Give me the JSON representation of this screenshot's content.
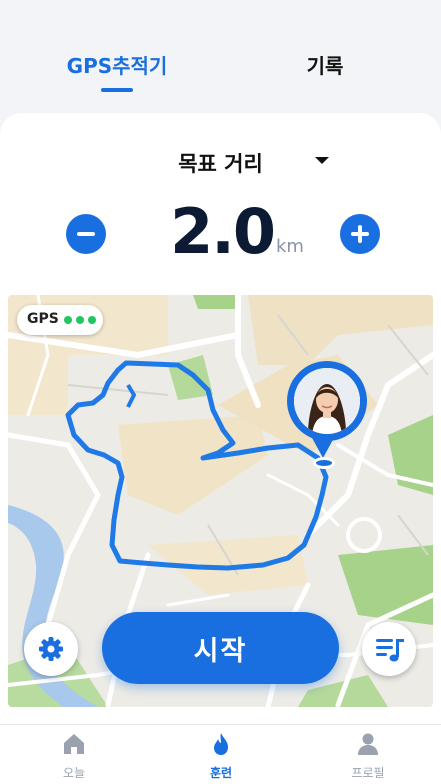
{
  "tabs": {
    "gps": "GPS추적기",
    "record": "기록",
    "active": "gps"
  },
  "goal": {
    "label": "목표 거리",
    "value": "2.0",
    "unit": "km"
  },
  "map": {
    "gps_label": "GPS",
    "gps_signal_bars": 3
  },
  "actions": {
    "start_label": "시작"
  },
  "bottom_nav": {
    "items": [
      {
        "label": "오늘",
        "icon": "home-icon"
      },
      {
        "label": "훈련",
        "icon": "flame-icon"
      },
      {
        "label": "프로필",
        "icon": "person-icon"
      }
    ],
    "active_index": 1
  },
  "colors": {
    "accent": "#1a6fe0",
    "route": "#1f7ae8",
    "gps_dot": "#22c55e",
    "park": "#a7d28a",
    "water": "#a8c8ec"
  }
}
